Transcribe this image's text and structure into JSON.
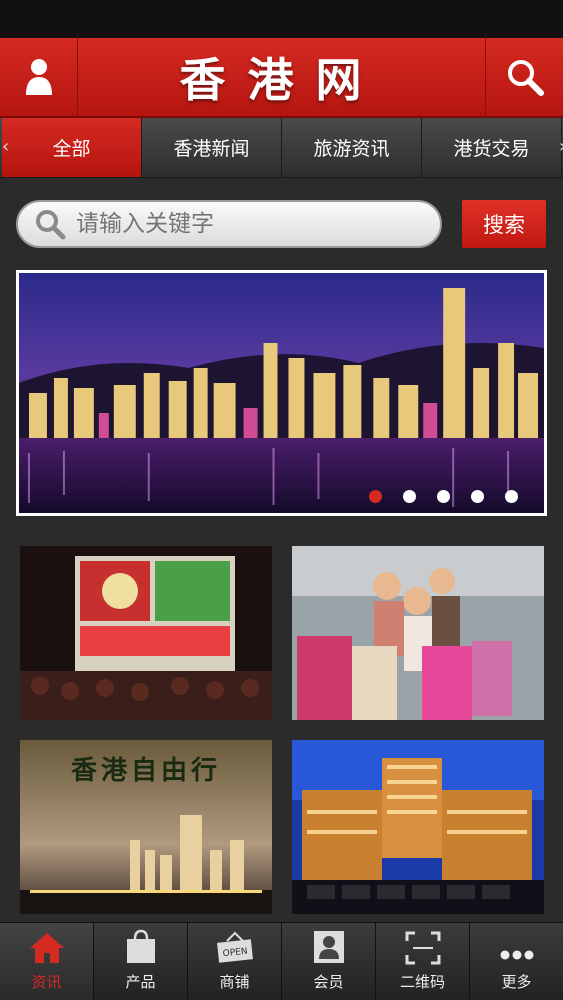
{
  "header": {
    "title": "香港网",
    "user_icon": "user-icon",
    "search_icon": "search-icon"
  },
  "tabs": [
    {
      "label": "全部",
      "active": true
    },
    {
      "label": "香港新闻",
      "active": false
    },
    {
      "label": "旅游资讯",
      "active": false
    },
    {
      "label": "港货交易",
      "active": false
    }
  ],
  "search": {
    "placeholder": "请输入关键字",
    "button_label": "搜索"
  },
  "banner": {
    "slide_count": 5,
    "active_slide": 1
  },
  "tiles": [
    {
      "caption": ""
    },
    {
      "caption": ""
    },
    {
      "caption": "香港自由行"
    },
    {
      "caption": ""
    }
  ],
  "tabbar": [
    {
      "label": "资讯",
      "icon": "home-icon",
      "active": true
    },
    {
      "label": "产品",
      "icon": "shopping-bag-icon",
      "active": false
    },
    {
      "label": "商铺",
      "icon": "open-sign-icon",
      "active": false
    },
    {
      "label": "会员",
      "icon": "member-card-icon",
      "active": false
    },
    {
      "label": "二维码",
      "icon": "qr-scan-icon",
      "active": false
    },
    {
      "label": "更多",
      "icon": "more-icon",
      "active": false
    }
  ],
  "colors": {
    "accent": "#d42a22",
    "dark": "#2b2b2b"
  }
}
